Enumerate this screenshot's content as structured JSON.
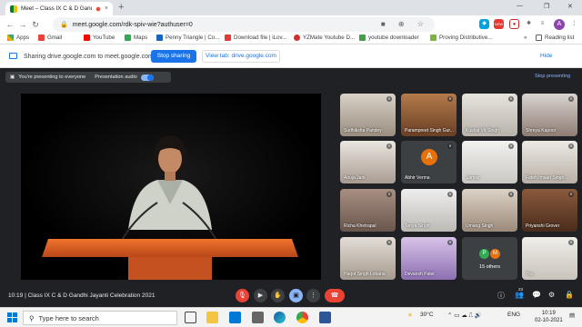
{
  "browser": {
    "tab_title": "Meet – Class IX C & D Gandhi",
    "tab_close": "×",
    "new_tab": "+",
    "window_controls": [
      "—",
      "❐",
      "✕"
    ],
    "url": "meet.google.com/rdk-spiv-wie?authuser=0",
    "profile_initial": "A",
    "bookmarks": [
      "Apps",
      "Gmail",
      "YouTube",
      "Maps",
      "Penny Triangle | Co...",
      "Download file | iLov...",
      "YZMate Youtube D...",
      "youtube downloader",
      "Proving Distributive..."
    ],
    "reading_list": "Reading list",
    "more_bookmarks": "»"
  },
  "share_bar": {
    "message": "Sharing drive.google.com to meet.google.com",
    "stop_label": "Stop sharing",
    "view_label": "View tab: drive.google.com",
    "hide_label": "Hide"
  },
  "presentation": {
    "status": "You're presenting to everyone",
    "audio_label": "Presentation audio",
    "stop_label": "Stop presenting"
  },
  "participants": [
    {
      "name": "Sudhiksha Pandey"
    },
    {
      "name": "Parampreet Singh Gur..."
    },
    {
      "name": "Kushal Vir Singh"
    },
    {
      "name": "Shreya Kapoor"
    },
    {
      "name": "Anuja Jain"
    },
    {
      "name": "Abhir Verma",
      "initial": "A"
    },
    {
      "name": "Samay"
    },
    {
      "name": "Fateh Imaan Singh..."
    },
    {
      "name": "Richa Khetrapal"
    },
    {
      "name": "Tanya Singh"
    },
    {
      "name": "Umang Singh"
    },
    {
      "name": "Priyanshi Grover"
    },
    {
      "name": "Harjot Singh Lobana"
    },
    {
      "name": "Devansh Patel"
    },
    {
      "name": "15 others",
      "initials": [
        "P",
        "M"
      ]
    },
    {
      "name": "You"
    }
  ],
  "meeting": {
    "time": "10:19",
    "separator": "|",
    "title": "Class IX C & D Gandhi Jayanti Celebration 2021",
    "participant_count": "23"
  },
  "taskbar": {
    "search_placeholder": "Type here to search",
    "weather": "30°C",
    "language": "ENG",
    "time": "10:19",
    "date": "02-10-2021"
  },
  "colors": {
    "accent": "#1a73e8",
    "hangup": "#ea4335",
    "meet_bg": "#202124"
  }
}
